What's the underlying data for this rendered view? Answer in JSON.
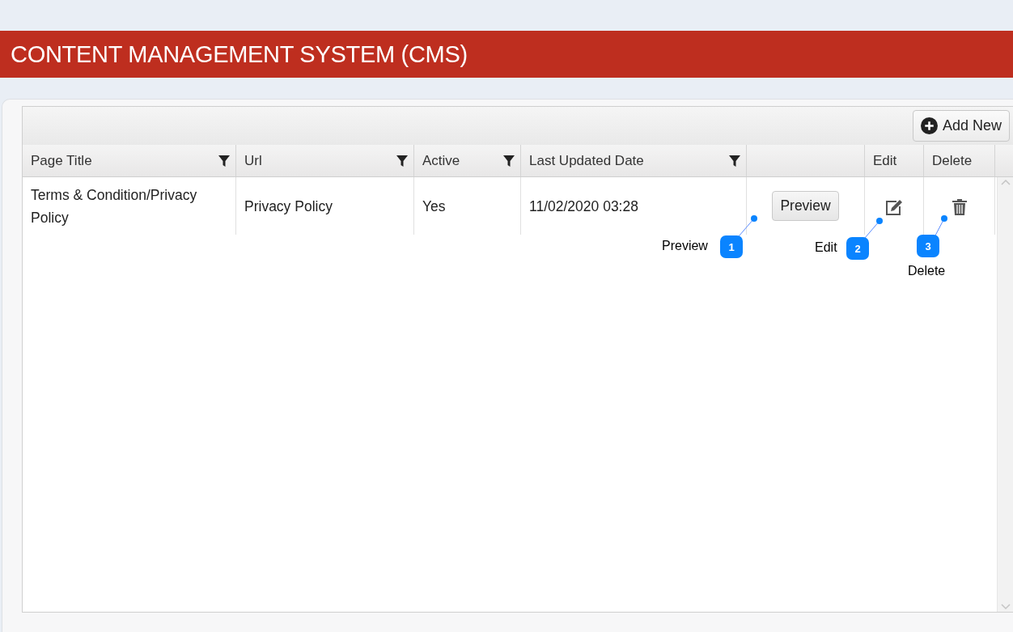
{
  "header": {
    "title": "CONTENT MANAGEMENT SYSTEM (CMS)"
  },
  "toolbar": {
    "add_button": "Add New"
  },
  "table": {
    "columns": [
      {
        "label": "Page Title",
        "filter": true
      },
      {
        "label": "Url",
        "filter": true
      },
      {
        "label": "Active",
        "filter": true
      },
      {
        "label": "Last Updated Date",
        "filter": true
      },
      {
        "filter": false
      },
      {
        "label": "Edit",
        "filter": false
      },
      {
        "label": "Delete",
        "filter": false
      }
    ],
    "rows": [
      {
        "page_title": "Terms & Condition/Privacy Policy",
        "url": "Privacy Policy",
        "active": "Yes",
        "last_updated": "11/02/2020 03:28",
        "preview_button": "Preview"
      }
    ]
  },
  "callouts": [
    {
      "number": "1",
      "label": "Preview"
    },
    {
      "number": "2",
      "label": "Edit"
    },
    {
      "number": "3",
      "label": "Delete"
    }
  ]
}
